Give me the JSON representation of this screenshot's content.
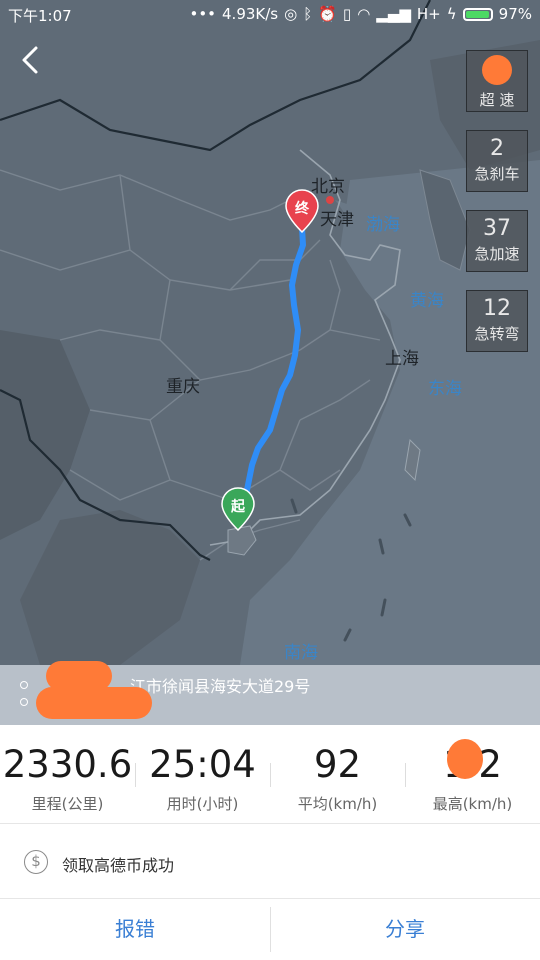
{
  "status_bar": {
    "time": "下午1:07",
    "network_speed": "4.93K/s",
    "network_type": "H+",
    "battery": "97%",
    "battery_level": 0.97,
    "icons": [
      "more-dots-icon",
      "hotspot-icon",
      "bluetooth-icon",
      "alarm-icon",
      "vibrate-icon",
      "wifi-icon",
      "signal-icon",
      "charging-icon",
      "battery-icon"
    ]
  },
  "map": {
    "cities": {
      "beijing": "北京",
      "tianjin": "天津",
      "shanghai": "上海",
      "chongqing": "重庆"
    },
    "seas": {
      "bohai": "渤海",
      "yellow": "黄海",
      "east": "东海",
      "south": "南海"
    },
    "start_marker": "起",
    "end_marker": "终",
    "route_color": "#2f8df7",
    "start_color": "#3aa75a",
    "end_color": "#e8424e"
  },
  "side_panel": [
    {
      "value": "",
      "label": "超 速"
    },
    {
      "value": "2",
      "label": "急刹车"
    },
    {
      "value": "37",
      "label": "急加速"
    },
    {
      "value": "12",
      "label": "急转弯"
    }
  ],
  "addresses": {
    "start": "江市徐闻县海安大道29号",
    "end": ""
  },
  "stats": [
    {
      "value": "2330.6",
      "label": "里程(公里)"
    },
    {
      "value": "25:04",
      "label": "用时(小时)"
    },
    {
      "value": "92",
      "label": "平均(km/h)"
    },
    {
      "value": "1 2",
      "label": "最高(km/h)"
    }
  ],
  "coin_message": "领取高德币成功",
  "coin_icon": "$",
  "buttons": {
    "report": "报错",
    "share": "分享"
  },
  "colors": {
    "accent": "#3a7fd4",
    "redaction": "#ff7a37"
  }
}
